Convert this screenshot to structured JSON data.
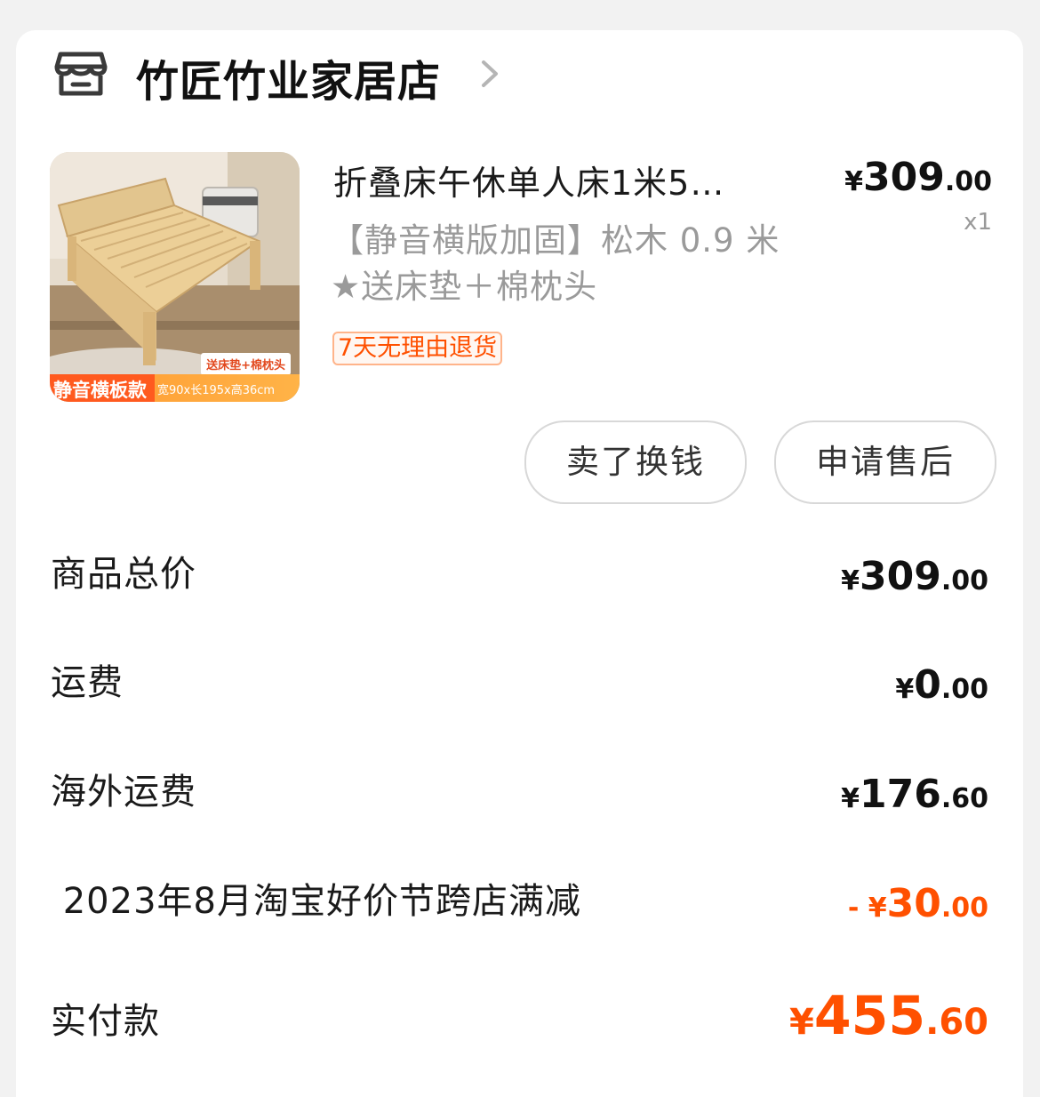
{
  "store": {
    "name": "竹匠竹业家居店"
  },
  "product": {
    "title": "折叠床午休单人床1米5…",
    "sku": "【静音横版加固】松木 0.9 米 ★送床垫＋棉枕头",
    "return_badge": "7天无理由退货",
    "thumb_tag": "送床垫+棉枕头",
    "thumb_banner_main": "静音横板款",
    "thumb_banner_spec": "宽90x长195x高36cm",
    "price": {
      "currency": "¥",
      "int": "309",
      "dec": ".00"
    },
    "quantity": "x1"
  },
  "actions": {
    "sell_label": "卖了换钱",
    "after_sale_label": "申请售后"
  },
  "summary": {
    "goods_total": {
      "label": "商品总价",
      "currency": "¥",
      "int": "309",
      "dec": ".00"
    },
    "shipping": {
      "label": "运费",
      "currency": "¥",
      "int": "0",
      "dec": ".00"
    },
    "overseas_shipping": {
      "label": "海外运费",
      "currency": "¥",
      "int": "176",
      "dec": ".60"
    },
    "discount": {
      "label": " 2023年8月淘宝好价节跨店满减",
      "prefix": "- ",
      "currency": "¥",
      "int": "30",
      "dec": ".00"
    },
    "paid": {
      "label": "实付款",
      "currency": "¥",
      "int": "455",
      "dec": ".60"
    }
  },
  "colors": {
    "accent": "#ff5000",
    "text": "#1a1a1a",
    "muted": "#9a9a9a"
  }
}
